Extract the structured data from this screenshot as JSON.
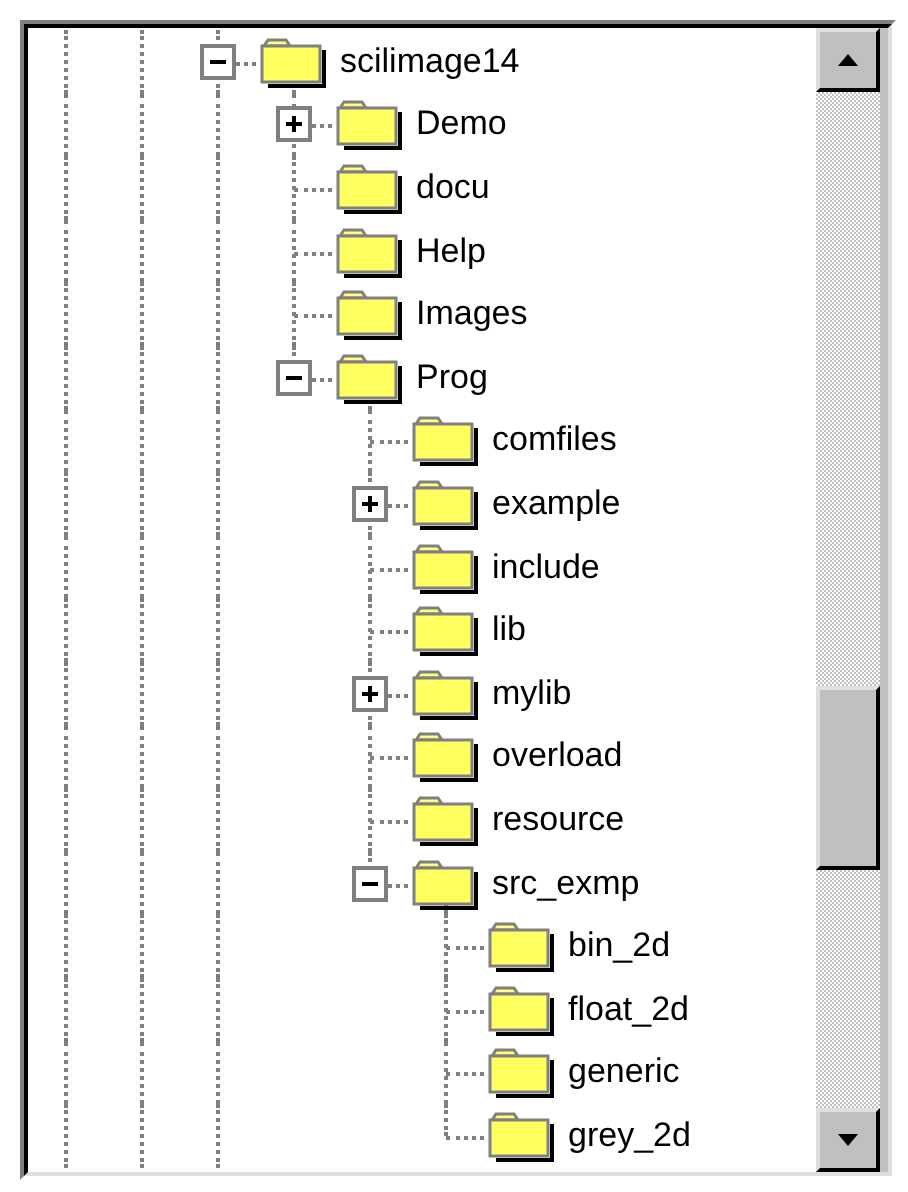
{
  "tree": [
    {
      "label": "scilimage14",
      "expanded": true,
      "children": [
        {
          "label": "Demo",
          "expanded": false
        },
        {
          "label": "docu"
        },
        {
          "label": "Help"
        },
        {
          "label": "Images"
        },
        {
          "label": "Prog",
          "expanded": true,
          "children": [
            {
              "label": "comfiles"
            },
            {
              "label": "example",
              "expanded": false
            },
            {
              "label": "include"
            },
            {
              "label": "lib"
            },
            {
              "label": "mylib",
              "expanded": false
            },
            {
              "label": "overload"
            },
            {
              "label": "resource"
            },
            {
              "label": "src_exmp",
              "expanded": true,
              "children": [
                {
                  "label": "bin_2d"
                },
                {
                  "label": "float_2d"
                },
                {
                  "label": "generic"
                },
                {
                  "label": "grey_2d"
                }
              ]
            }
          ]
        }
      ]
    }
  ]
}
